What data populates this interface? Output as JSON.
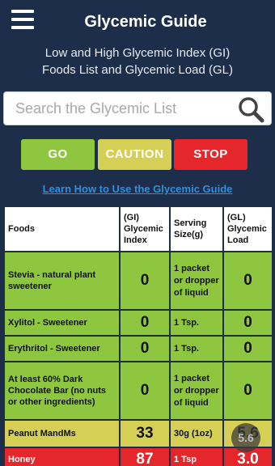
{
  "header": {
    "title": "Glycemic Guide",
    "menu_icon": "hamburger-menu-icon"
  },
  "subtitle": {
    "line1": "Low and High Glycemic Index (GI)",
    "line2": "Foods List and Glycemic Load (GL)"
  },
  "search": {
    "placeholder": "Search the Glycemic List",
    "icon": "search-icon"
  },
  "filters": {
    "go": "GO",
    "caution": "CAUTION",
    "stop": "STOP"
  },
  "colors": {
    "background": "#1c2e4a",
    "go": "#8ec73f",
    "caution": "#d5cf55",
    "stop": "#e5262a",
    "link": "#2f8fe0"
  },
  "learn_link": "Learn How to Use the Glycemic Guide",
  "table": {
    "headers": {
      "foods": "Foods",
      "gi": "(GI) Glycemic Index",
      "serving": "Serving Size(g)",
      "gl": "(GL) Glycemic Load"
    },
    "rows": [
      {
        "food": "Stevia - natural plant sweetener",
        "gi": "0",
        "serving": "1 packet or dropper of liquid",
        "gl": "0",
        "status": "green"
      },
      {
        "food": "Xylitol - Sweetener",
        "gi": "0",
        "serving": "1 Tsp.",
        "gl": "0",
        "status": "green"
      },
      {
        "food": "Erythritol - Sweetener",
        "gi": "0",
        "serving": "1 Tsp.",
        "gl": "0",
        "status": "green"
      },
      {
        "food": "At least 60% Dark Chocolate Bar (no nuts or other ingredients)",
        "gi": "0",
        "serving": "1 packet or dropper of liquid",
        "gl": "0",
        "status": "green"
      },
      {
        "food": "Peanut MandMs",
        "gi": "33",
        "serving": "30g (1oz)",
        "gl": "5.6",
        "status": "yellow"
      },
      {
        "food": "Honey",
        "gi": "87",
        "serving": "1 Tsp",
        "gl": "3.0",
        "status": "red"
      }
    ]
  },
  "fab": {
    "label": "5.6"
  }
}
